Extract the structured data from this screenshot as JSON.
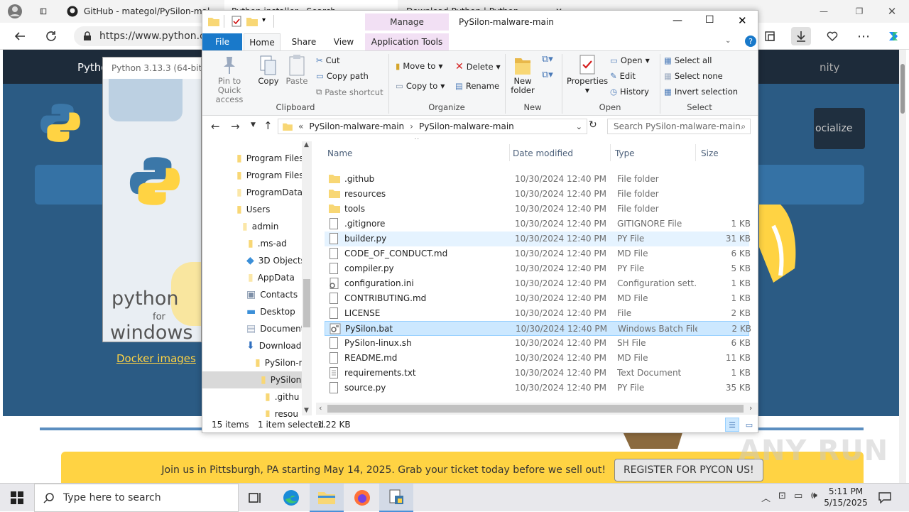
{
  "browser": {
    "tabs": [
      {
        "label": "GitHub - mategol/PySilon-mal"
      },
      {
        "label": "Python installer - Search"
      },
      {
        "label": "Download Python | Python"
      }
    ],
    "url": "https://www.python.o"
  },
  "site": {
    "nav_item": "Pytho",
    "nav_right": "nity",
    "socialize": "ocialize",
    "docker_link": "Docker images",
    "banner_text": "Join us in Pittsburgh, PA starting May 14, 2025. Grab your ticket today before we sell out!",
    "register_button": "REGISTER FOR PYCON US!"
  },
  "installer": {
    "title": "Python 3.13.3 (64-bit)",
    "brand_python": "python",
    "brand_for": "for",
    "brand_windows": "windows"
  },
  "explorer": {
    "title": "PySilon-malware-main",
    "manage_tab": "Manage",
    "tabs": {
      "file": "File",
      "home": "Home",
      "share": "Share",
      "view": "View",
      "app_tools": "Application Tools"
    },
    "ribbon": {
      "pin": "Pin to Quick access",
      "copy": "Copy",
      "paste": "Paste",
      "cut": "Cut",
      "copy_path": "Copy path",
      "paste_shortcut": "Paste shortcut",
      "clipboard": "Clipboard",
      "move_to": "Move to",
      "copy_to": "Copy to",
      "delete": "Delete",
      "rename": "Rename",
      "organize": "Organize",
      "new_folder": "New folder",
      "new": "New",
      "properties": "Properties",
      "open_btn": "Open",
      "edit": "Edit",
      "history": "History",
      "open_group": "Open",
      "select_all": "Select all",
      "select_none": "Select none",
      "invert_selection": "Invert selection",
      "select_group": "Select"
    },
    "breadcrumb": [
      "PySilon-malware-main",
      "PySilon-malware-main"
    ],
    "search_placeholder": "Search PySilon-malware-main",
    "nav_tree": [
      "Program Files",
      "Program Files",
      "ProgramData",
      "Users",
      "admin",
      ".ms-ad",
      "3D Objects",
      "AppData",
      "Contacts",
      "Desktop",
      "Documents",
      "Downloads",
      "PySilon-m",
      "PySilon",
      ".githu",
      "resou"
    ],
    "columns": {
      "name": "Name",
      "date": "Date modified",
      "type": "Type",
      "size": "Size"
    },
    "files": [
      {
        "name": ".github",
        "date": "10/30/2024 12:40 PM",
        "type": "File folder",
        "size": "",
        "icon": "folder"
      },
      {
        "name": "resources",
        "date": "10/30/2024 12:40 PM",
        "type": "File folder",
        "size": "",
        "icon": "folder"
      },
      {
        "name": "tools",
        "date": "10/30/2024 12:40 PM",
        "type": "File folder",
        "size": "",
        "icon": "folder"
      },
      {
        "name": ".gitignore",
        "date": "10/30/2024 12:40 PM",
        "type": "GITIGNORE File",
        "size": "1 KB",
        "icon": "file"
      },
      {
        "name": "builder.py",
        "date": "10/30/2024 12:40 PM",
        "type": "PY File",
        "size": "31 KB",
        "icon": "file"
      },
      {
        "name": "CODE_OF_CONDUCT.md",
        "date": "10/30/2024 12:40 PM",
        "type": "MD File",
        "size": "6 KB",
        "icon": "file"
      },
      {
        "name": "compiler.py",
        "date": "10/30/2024 12:40 PM",
        "type": "PY File",
        "size": "5 KB",
        "icon": "file"
      },
      {
        "name": "configuration.ini",
        "date": "10/30/2024 12:40 PM",
        "type": "Configuration sett...",
        "size": "1 KB",
        "icon": "gear-file"
      },
      {
        "name": "CONTRIBUTING.md",
        "date": "10/30/2024 12:40 PM",
        "type": "MD File",
        "size": "1 KB",
        "icon": "file"
      },
      {
        "name": "LICENSE",
        "date": "10/30/2024 12:40 PM",
        "type": "File",
        "size": "2 KB",
        "icon": "file"
      },
      {
        "name": "PySilon.bat",
        "date": "10/30/2024 12:40 PM",
        "type": "Windows Batch File",
        "size": "2 KB",
        "icon": "bat-file"
      },
      {
        "name": "PySilon-linux.sh",
        "date": "10/30/2024 12:40 PM",
        "type": "SH File",
        "size": "6 KB",
        "icon": "file"
      },
      {
        "name": "README.md",
        "date": "10/30/2024 12:40 PM",
        "type": "MD File",
        "size": "11 KB",
        "icon": "file"
      },
      {
        "name": "requirements.txt",
        "date": "10/30/2024 12:40 PM",
        "type": "Text Document",
        "size": "1 KB",
        "icon": "text-file"
      },
      {
        "name": "source.py",
        "date": "10/30/2024 12:40 PM",
        "type": "PY File",
        "size": "35 KB",
        "icon": "file"
      }
    ],
    "status": {
      "count": "15 items",
      "selected": "1 item selected",
      "size": "1.22 KB"
    }
  },
  "taskbar": {
    "search_placeholder": "Type here to search",
    "time": "5:11 PM",
    "date": "5/15/2025"
  },
  "watermark": "ANY RUN",
  "colors": {
    "accent": "#0078d7",
    "selection": "#cce8ff",
    "python_blue": "#2b5b84",
    "pycon_yellow": "#ffd343"
  }
}
